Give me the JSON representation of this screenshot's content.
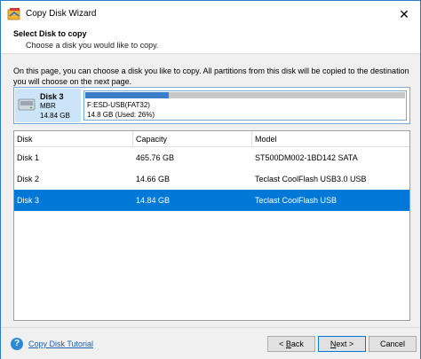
{
  "window": {
    "title": "Copy Disk Wizard",
    "close_glyph": "✕"
  },
  "header": {
    "title": "Select Disk to copy",
    "subtitle": "Choose a disk you would like to copy."
  },
  "description": "On this page, you can choose a disk you like to copy. All partitions from this disk will be copied to the destination you will choose on the next page.",
  "selected_disk": {
    "name": "Disk 3",
    "type": "MBR",
    "size": "14.84 GB",
    "partition": {
      "label": "F:ESD-USB(FAT32)",
      "usage": "14.8 GB (Used: 26%)",
      "used_fraction": 0.26
    }
  },
  "table": {
    "columns": [
      "Disk",
      "Capacity",
      "Model"
    ],
    "rows": [
      {
        "disk": "Disk 1",
        "capacity": "465.76 GB",
        "model": "ST500DM002-1BD142 SATA",
        "selected": false
      },
      {
        "disk": "Disk 2",
        "capacity": "14.66 GB",
        "model": "Teclast CoolFlash USB3.0 USB",
        "selected": false
      },
      {
        "disk": "Disk 3",
        "capacity": "14.84 GB",
        "model": "Teclast CoolFlash USB",
        "selected": true
      }
    ]
  },
  "footer": {
    "help_icon": "question-mark-icon",
    "help_glyph": "?",
    "tutorial_link": "Copy Disk Tutorial",
    "back_mark": "< ",
    "back_key": "B",
    "back_rest": "ack",
    "next_key": "N",
    "next_rest": "ext >",
    "cancel_label": "Cancel"
  },
  "colors": {
    "accent": "#0078d7",
    "partition_fill": "#3d7cc9"
  }
}
